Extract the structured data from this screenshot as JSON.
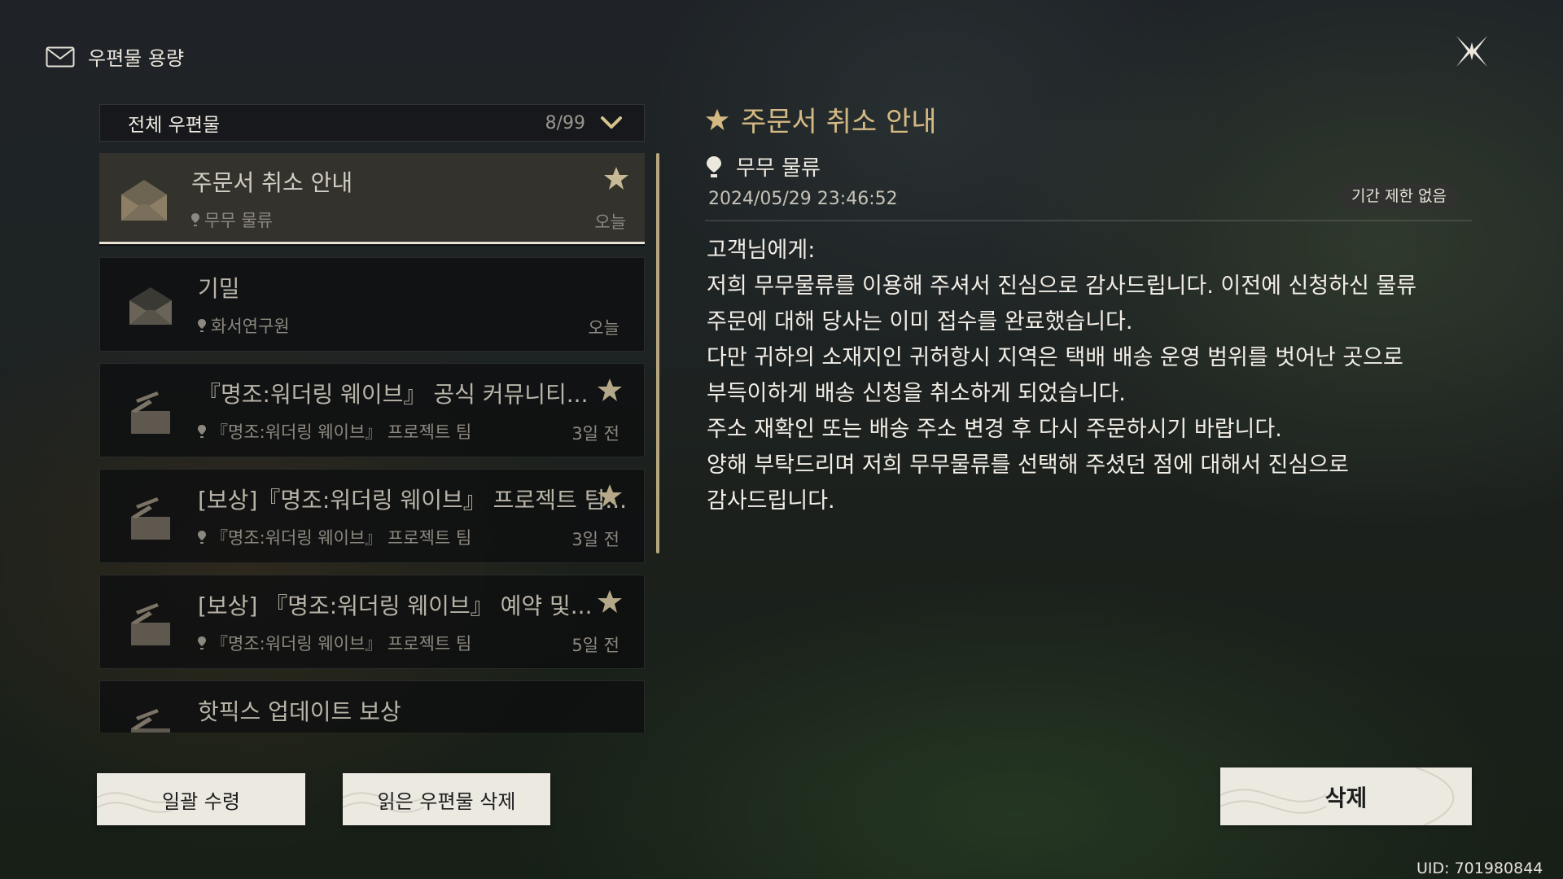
{
  "header": {
    "title": "우편물 용량",
    "icon": "mail-outline-icon"
  },
  "close": {
    "icon": "close-x-icon"
  },
  "list": {
    "filter_label": "전체 우편물",
    "count": "8/99",
    "items": [
      {
        "title": "주문서 취소 안내",
        "sender": "무무 물류",
        "time": "오늘",
        "starred": true,
        "icon": "envelope-icon"
      },
      {
        "title": "기밀",
        "sender": "화서연구원",
        "time": "오늘",
        "starred": false,
        "icon": "envelope-icon"
      },
      {
        "title": "『명조:워더링 웨이브』 공식 커뮤니티...",
        "sender": "『명조:워더링 웨이브』 프로젝트 팀",
        "time": "3일 전",
        "starred": true,
        "icon": "opened-parcel-icon"
      },
      {
        "title": "[보상]『명조:워더링 웨이브』 프로젝트 팀...",
        "sender": "『명조:워더링 웨이브』 프로젝트 팀",
        "time": "3일 전",
        "starred": true,
        "icon": "opened-parcel-icon"
      },
      {
        "title": "[보상] 『명조:워더링 웨이브』 예약 및...",
        "sender": "『명조:워더링 웨이브』 프로젝트 팀",
        "time": "5일 전",
        "starred": true,
        "icon": "opened-parcel-icon"
      },
      {
        "title": "핫픽스 업데이트 보상",
        "sender": "",
        "time": "",
        "starred": false,
        "icon": "opened-parcel-icon"
      }
    ]
  },
  "detail": {
    "title": "주문서 취소 안내",
    "sender": "무무 물류",
    "date": "2024/05/29 23:46:52",
    "expiry": "기간 제한 없음",
    "body": [
      "고객님에게:",
      "저희 무무물류를 이용해 주셔서 진심으로 감사드립니다. 이전에 신청하신 물류",
      "주문에 대해 당사는 이미 접수를 완료했습니다.",
      "다만 귀하의 소재지인 귀허항시 지역은 택배 배송 운영 범위를 벗어난 곳으로",
      "부득이하게 배송 신청을 취소하게 되었습니다.",
      "주소 재확인 또는 배송 주소 변경 후 다시 주문하시기 바랍니다.",
      "양해 부탁드리며 저희 무무물류를 선택해 주셨던 점에 대해서 진심으로",
      "감사드립니다."
    ]
  },
  "buttons": {
    "claim_all": "일괄 수령",
    "delete_read": "읽은 우편물 삭제",
    "delete": "삭제"
  },
  "uid": "UID: 701980844",
  "colors": {
    "accent_gold": "#d4b983",
    "star": "#c8ba97",
    "button_bg": "#ece9e1",
    "scrollbar": "#b8a77e"
  }
}
